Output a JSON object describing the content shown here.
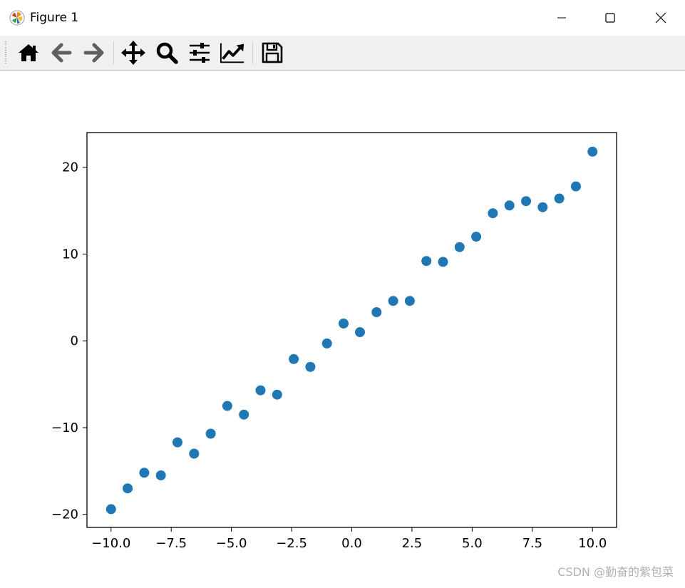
{
  "window": {
    "title": "Figure 1",
    "controls": [
      "minimize",
      "maximize",
      "close"
    ]
  },
  "toolbar": {
    "tools": [
      {
        "name": "home-icon",
        "label": "Home"
      },
      {
        "name": "back-icon",
        "label": "Back"
      },
      {
        "name": "forward-icon",
        "label": "Forward"
      },
      {
        "name": "pan-icon",
        "label": "Pan"
      },
      {
        "name": "zoom-icon",
        "label": "Zoom"
      },
      {
        "name": "subplots-icon",
        "label": "Configure subplots"
      },
      {
        "name": "edit-axis-icon",
        "label": "Edit axis"
      },
      {
        "name": "save-icon",
        "label": "Save"
      }
    ]
  },
  "watermark": "CSDN @勤奋的紫包菜",
  "colors": {
    "marker": "#1f77b4",
    "toolbar_bg": "#f0f0f0"
  },
  "chart_data": {
    "type": "scatter",
    "title": "",
    "xlabel": "",
    "ylabel": "",
    "xlim": [
      -11.0,
      11.0
    ],
    "ylim": [
      -21.5,
      24.0
    ],
    "xticks": [
      -10.0,
      -7.5,
      -5.0,
      -2.5,
      0.0,
      2.5,
      5.0,
      7.5,
      10.0
    ],
    "xtick_labels": [
      "−10.0",
      "−7.5",
      "−5.0",
      "−2.5",
      "0.0",
      "2.5",
      "5.0",
      "7.5",
      "10.0"
    ],
    "yticks": [
      -20,
      -10,
      0,
      10,
      20
    ],
    "ytick_labels": [
      "−20",
      "−10",
      "0",
      "10",
      "20"
    ],
    "grid": false,
    "series": [
      {
        "x": [
          -10.0,
          -9.31,
          -8.62,
          -7.93,
          -7.24,
          -6.55,
          -5.86,
          -5.17,
          -4.48,
          -3.79,
          -3.1,
          -2.41,
          -1.72,
          -1.03,
          -0.34,
          0.34,
          1.03,
          1.72,
          2.41,
          3.1,
          3.79,
          4.48,
          5.17,
          5.86,
          6.55,
          7.24,
          7.93,
          8.62,
          9.31,
          10.0
        ],
        "y": [
          -19.4,
          -17.0,
          -15.2,
          -15.5,
          -11.7,
          -13.0,
          -10.7,
          -7.5,
          -8.5,
          -5.7,
          -6.2,
          -2.1,
          -3.0,
          -0.3,
          2.0,
          1.0,
          3.3,
          4.6,
          4.6,
          9.2,
          9.1,
          10.8,
          12.0,
          14.7,
          15.6,
          16.1,
          15.4,
          16.4,
          17.8,
          21.8
        ]
      }
    ]
  }
}
